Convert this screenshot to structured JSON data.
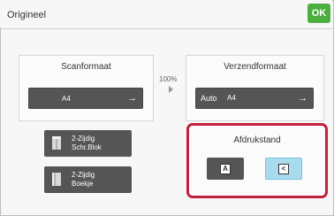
{
  "window": {
    "title": "Origineel",
    "ok_label": "OK"
  },
  "scan": {
    "label": "Scanformaat",
    "value": "A4"
  },
  "zoom": {
    "value": "100%"
  },
  "send": {
    "label": "Verzendformaat",
    "mode": "Auto",
    "value": "A4"
  },
  "duplex": [
    {
      "label_line1": "2-Zijdig",
      "label_line2": "Schr.Blok",
      "icon": "book-icon"
    },
    {
      "label_line1": "2-Zijdig",
      "label_line2": "Boekje",
      "icon": "booklet-icon"
    }
  ],
  "orientation": {
    "label": "Afdrukstand",
    "options": [
      {
        "glyph": "A",
        "icon": "portrait-orientation-icon",
        "selected": false
      },
      {
        "glyph": "<",
        "icon": "landscape-orientation-icon",
        "selected": true
      }
    ]
  },
  "colors": {
    "accent": "#4cae3f",
    "highlight": "#c2203a",
    "selected": "#a9dbef",
    "button": "#555555"
  }
}
